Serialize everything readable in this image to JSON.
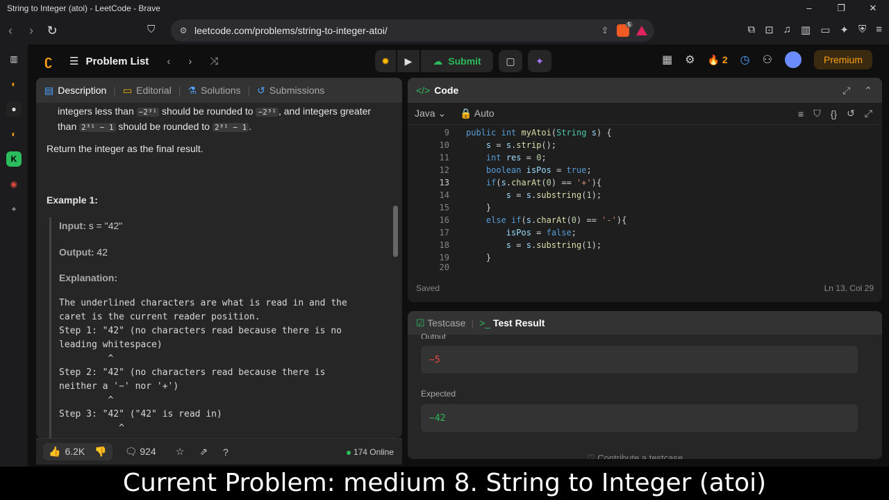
{
  "window": {
    "title": "String to Integer (atoi) - LeetCode - Brave",
    "min": "–",
    "max": "❐",
    "close": "✕"
  },
  "browser": {
    "url": "leetcode.com/problems/string-to-integer-atoi/",
    "brave_badge": "5"
  },
  "header": {
    "problem_list": "Problem List",
    "submit": "Submit",
    "streak": "2",
    "premium": "Premium"
  },
  "left": {
    "tabs": [
      "Description",
      "Editorial",
      "Solutions",
      "Submissions"
    ],
    "para1_a": "integers less than",
    "para1_c1": "−2³¹",
    "para1_b": "should be rounded to",
    "para1_c2": "−2³¹",
    "para1_c": ", and integers greater than",
    "para1_c3": "2³¹ − 1",
    "para1_d": "should be rounded to",
    "para1_c4": "2³¹ − 1",
    "para1_e": ".",
    "return_text": "Return the integer as the final result.",
    "example_title": "Example 1:",
    "input_label": "Input:",
    "input_value": "s = \"42\"",
    "output_label": "Output:",
    "output_value": "42",
    "explanation_label": "Explanation:",
    "explanation": "The underlined characters are what is read in and the\ncaret is the current reader position.\nStep 1: \"42\" (no characters read because there is no\nleading whitespace)\n         ^\nStep 2: \"42\" (no characters read because there is\nneither a '−' nor '+')\n         ^\nStep 3: \"42\" (\"42\" is read in)\n           ^",
    "footer": {
      "likes": "6.2K",
      "comments": "924",
      "online": "174 Online"
    }
  },
  "code": {
    "title": "Code",
    "language": "Java",
    "mode": "Auto",
    "saved": "Saved",
    "cursor": "Ln 13, Col 29",
    "lines": [
      {
        "n": "9"
      },
      {
        "n": "10"
      },
      {
        "n": "11"
      },
      {
        "n": "12"
      },
      {
        "n": "13"
      },
      {
        "n": "14"
      },
      {
        "n": "15"
      },
      {
        "n": "16"
      },
      {
        "n": "17"
      },
      {
        "n": "18"
      },
      {
        "n": "19"
      },
      {
        "n": "20"
      }
    ]
  },
  "result": {
    "tabs": [
      "Testcase",
      "Test Result"
    ],
    "output_label": "Output",
    "output_value": "−5",
    "expected_label": "Expected",
    "expected_value": "−42",
    "contribute": "Contribute a testcase"
  },
  "caption": "Current Problem: medium 8. String to Integer (atoi)"
}
